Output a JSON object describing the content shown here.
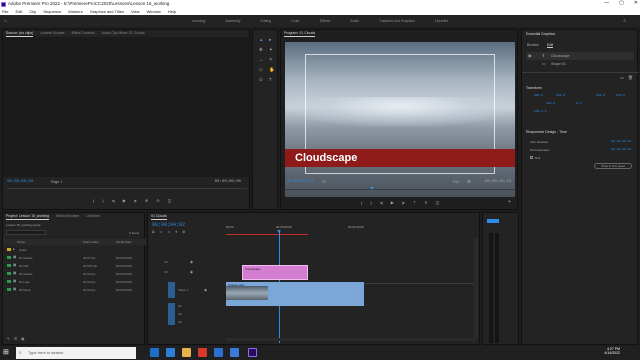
{
  "window": {
    "title": "Adobe Premiere Pro 2022 - E:\\PremiereProCC2020\\Lessons\\Lesson 15_working",
    "min": "—",
    "max": "▢",
    "close": "✕"
  },
  "menu": [
    "File",
    "Edit",
    "Clip",
    "Sequence",
    "Markers",
    "Graphics and Titles",
    "View",
    "Window",
    "Help"
  ],
  "workspaces": [
    "Learning",
    "Assembly",
    "Editing",
    "Color",
    "Effects",
    "Audio",
    "Captions and Graphics",
    "Libraries"
  ],
  "source_panel": {
    "tabs": [
      "Source: (no clips)",
      "Lumetri Scopes",
      "Effect Controls",
      "Audio Clip Mixer: 01 Clouds"
    ],
    "timecode_left": "00;00;00;00",
    "page_label": "Page 1",
    "timecode_right": "00;00;00;00"
  },
  "program_panel": {
    "title": "Program: 01 Clouds",
    "timecode": "00;00;04;02",
    "fit": "Fit",
    "quality": "Full",
    "duration": "00;00;10;13",
    "caption": "Cloudscape"
  },
  "essential_graphics": {
    "title": "Essential Graphics",
    "tabs": [
      "Browse",
      "Edit"
    ],
    "layers": [
      "Cloudscape",
      "Shape 01"
    ],
    "section_transform": "Transform",
    "values": [
      "960.0",
      "540.0",
      "100.0",
      "960.0",
      "540.0",
      "0.0",
      "100.0 %"
    ],
    "section_responsive": "Responsive Design - Time",
    "intro": "Intro Duration",
    "outro": "Outro Duration",
    "intro_val": "00:00:00:00",
    "outro_val": "00:00:00:00",
    "roll": "Roll",
    "button": "Show in Text panel"
  },
  "project_panel": {
    "tabs": [
      "Project: Lesson 15_working",
      "Media Browser",
      "Libraries"
    ],
    "file": "Lesson 15_working.prproj",
    "count": "6 items",
    "headers": [
      "Name",
      "Frame Rate",
      "Media Start"
    ],
    "items": [
      {
        "name": "Audio",
        "rate": "",
        "start": "",
        "color": "#d6a62b"
      },
      {
        "name": "01 Clouds",
        "rate": "29.97 fps",
        "start": "00;00;00;00",
        "color": "#2d9a4a"
      },
      {
        "name": "02 Cliff",
        "rate": "23.976 fps",
        "start": "00;00;00;00",
        "color": "#2d9a4a"
      },
      {
        "name": "03 Clouds",
        "rate": "24.00 fps",
        "start": "00;00;00;00",
        "color": "#2d9a4a"
      },
      {
        "name": "04 Logo",
        "rate": "24.00 fps",
        "start": "00;00;00;00",
        "color": "#2d9a4a"
      },
      {
        "name": "05 Mock",
        "rate": "24.00 fps",
        "start": "00;00;00;00",
        "color": "#2d9a4a"
      }
    ]
  },
  "timeline": {
    "tab": "01 Clouds",
    "timecode": "00;00;04;02",
    "ruler": [
      "00;00",
      "00;00;05;00",
      "00;00;10;00"
    ],
    "graphic_clip": "Cloudscape",
    "video_clip": "Clouds.mp4",
    "video_track_label": "Video 1",
    "tracks_v": [
      "V3",
      "V2",
      "V1"
    ],
    "tracks_a": [
      "A1",
      "A2",
      "A3"
    ]
  },
  "taskbar": {
    "search_placeholder": "Type here to search",
    "time": "4:27 PM",
    "date": "4/14/2022"
  }
}
